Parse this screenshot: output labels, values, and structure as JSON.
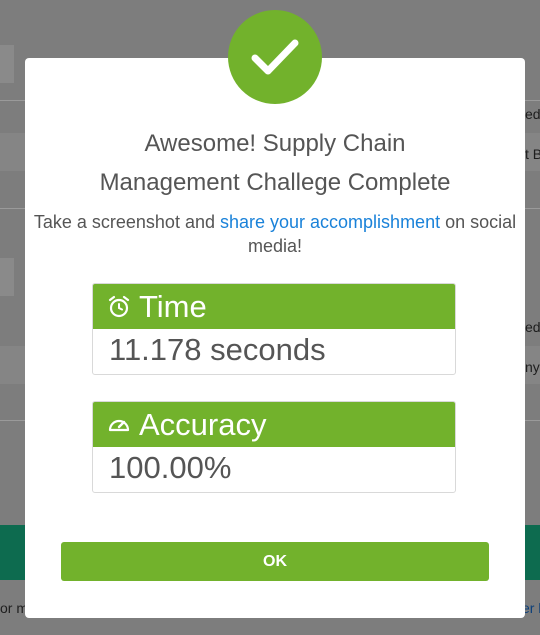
{
  "background": {
    "right_texts": [
      "ed",
      "t B",
      "ed",
      "ny"
    ],
    "bottom_left": "or m",
    "bottom_right": "er l"
  },
  "modal": {
    "icon": "check-icon",
    "title_line1": "Awesome! Supply Chain",
    "title_line2": "Management Challege Complete",
    "subtitle_pre": "Take a screenshot and ",
    "subtitle_link": "share your accomplishment",
    "subtitle_post": " on social media!",
    "time": {
      "icon": "alarm-clock-icon",
      "label": "Time",
      "value": "11.178 seconds"
    },
    "accuracy": {
      "icon": "gauge-icon",
      "label": "Accuracy",
      "value": "100.00%"
    },
    "ok_label": "OK"
  },
  "colors": {
    "accent_green": "#72b22c",
    "link_blue": "#1a82d9",
    "overlay_gray": "#7d7d7d"
  }
}
